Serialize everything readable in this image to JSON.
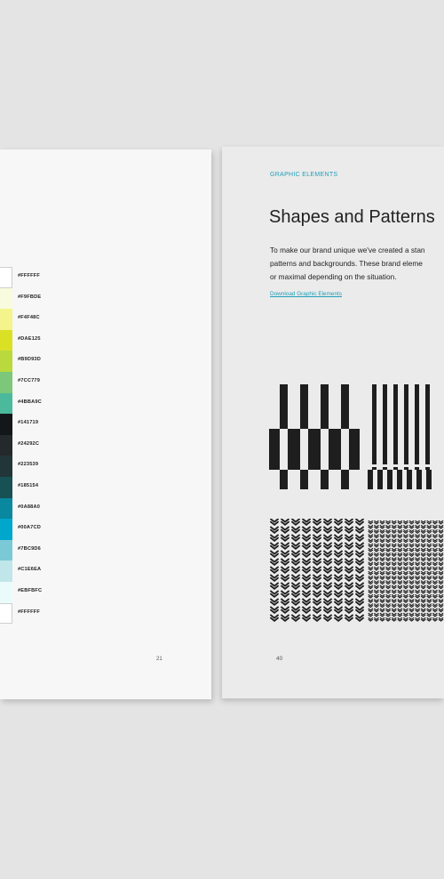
{
  "left_page": {
    "swatches": [
      {
        "hex": "#FFFFFF",
        "color": "#FFFFFF"
      },
      {
        "hex": "#F9FBDE",
        "color": "#F9FBDE"
      },
      {
        "hex": "#F4F48C",
        "color": "#F4F48C"
      },
      {
        "hex": "#DAE125",
        "color": "#DAE125"
      },
      {
        "hex": "#B9D93D",
        "color": "#B9D93D"
      },
      {
        "hex": "#7CC779",
        "color": "#7CC779"
      },
      {
        "hex": "#4BBA9C",
        "color": "#4BBA9C"
      },
      {
        "hex": "#141719",
        "color": "#141719"
      },
      {
        "hex": "#24292C",
        "color": "#24292C"
      },
      {
        "hex": "#223539",
        "color": "#223539"
      },
      {
        "hex": "#185154",
        "color": "#185154"
      },
      {
        "hex": "#0A88A0",
        "color": "#0A88A0"
      },
      {
        "hex": "#00A7CD",
        "color": "#00A7CD"
      },
      {
        "hex": "#7BC9D6",
        "color": "#7BC9D6"
      },
      {
        "hex": "#C1E6EA",
        "color": "#C1E6EA"
      },
      {
        "hex": "#EBFBFC",
        "color": "#EBFBFC"
      },
      {
        "hex": "#FFFFFF",
        "color": "#FFFFFF"
      }
    ],
    "page_number": "21"
  },
  "right_page": {
    "eyebrow": "GRAPHIC ELEMENTS",
    "title": "Shapes and Patterns",
    "body_line_1": "To make our brand unique we've created a stan",
    "body_line_2": "patterns and backgrounds. These brand eleme",
    "body_line_3": "or maximal depending on the situation.",
    "download_link": "Download Graphic Elements",
    "page_number": "40",
    "accent_color": "#1f9fba",
    "pattern_color": "#1e1e1e"
  }
}
